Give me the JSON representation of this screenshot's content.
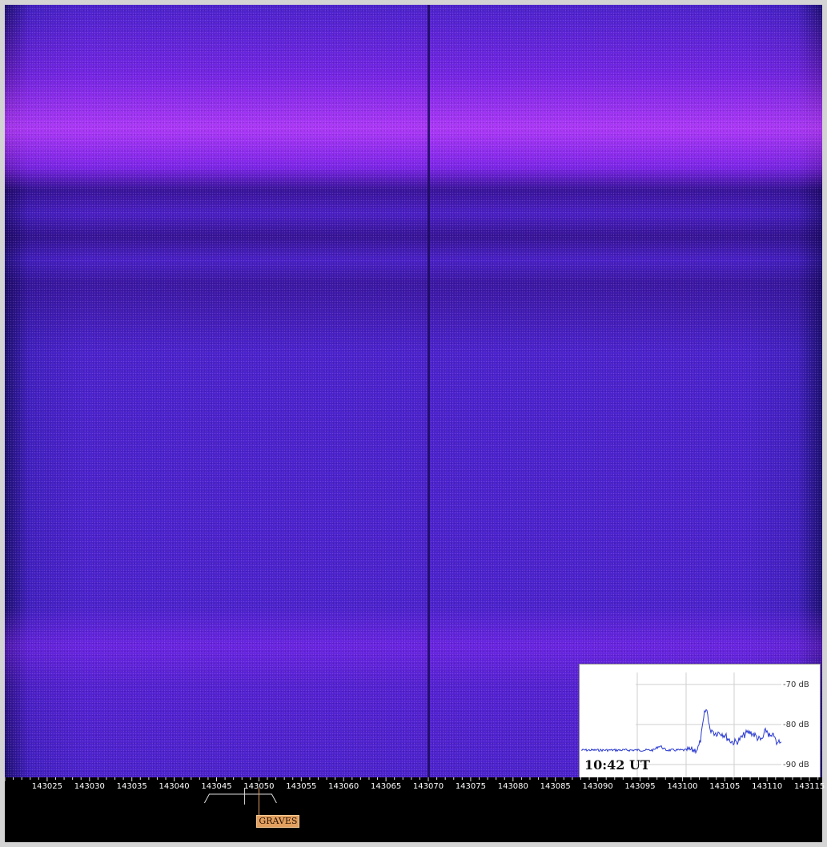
{
  "waterfall": {
    "colors": {
      "base": "#4a22cc",
      "bright": "#b040ff",
      "dark": "#1a0a5a"
    }
  },
  "spectrum_inset": {
    "time": "10:42 UT",
    "db_labels": [
      "-70 dB",
      "-80 dB",
      "-90 dB"
    ]
  },
  "frequency_axis": {
    "ticks": [
      "143025",
      "143030",
      "143035",
      "143040",
      "143045",
      "143050",
      "143055",
      "143060",
      "143065",
      "143070",
      "143075",
      "143080",
      "143085",
      "143090",
      "143095",
      "143100",
      "143105",
      "143110",
      "143115"
    ],
    "start": 143020,
    "end": 143116.5
  },
  "marker": {
    "label": "GRAVES",
    "frequency": 143050
  }
}
